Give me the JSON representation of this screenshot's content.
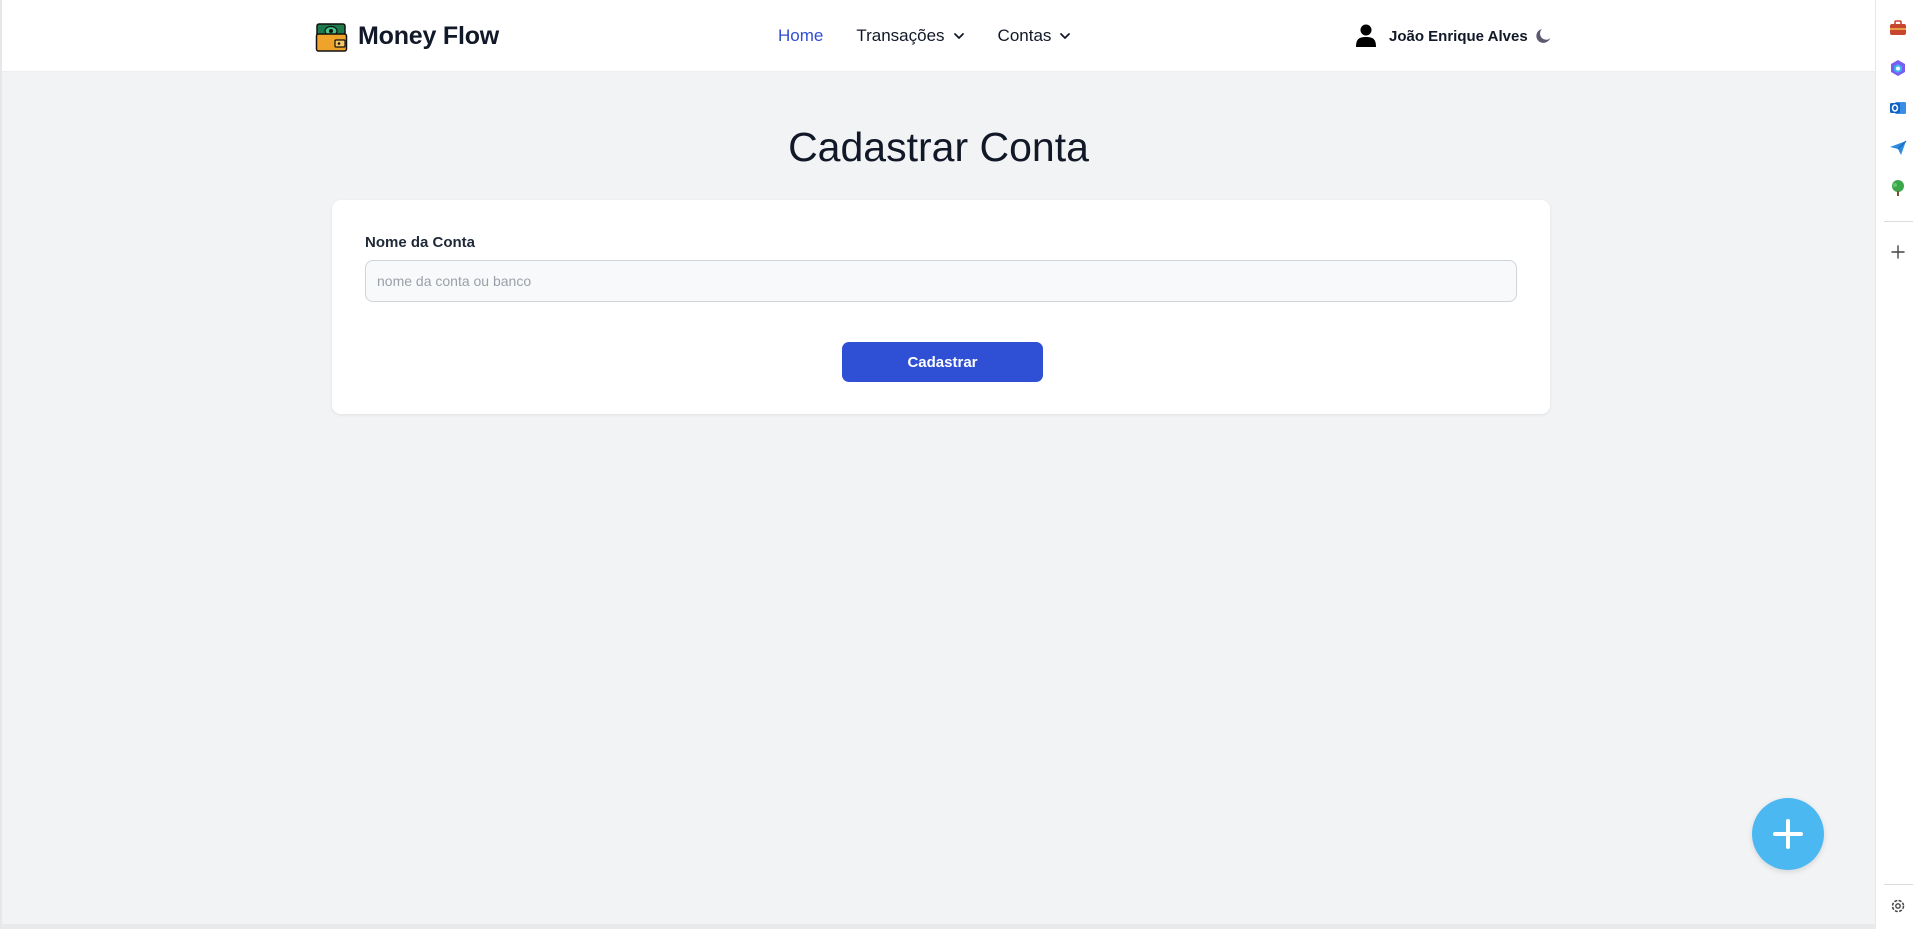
{
  "app": {
    "name": "Money Flow"
  },
  "nav": {
    "links": [
      {
        "label": "Home",
        "active": true
      },
      {
        "label": "Transações",
        "dropdown": true
      },
      {
        "label": "Contas",
        "dropdown": true
      }
    ]
  },
  "user": {
    "name": "João Enrique Alves",
    "theme_toggle_icon": "moon-icon"
  },
  "page": {
    "title": "Cadastrar Conta"
  },
  "form": {
    "account_name_label": "Nome da Conta",
    "account_name_placeholder": "nome da conta ou banco",
    "account_name_value": "",
    "submit_label": "Cadastrar"
  },
  "fab": {
    "icon": "plus-icon"
  },
  "browser_sidebar": {
    "icons": [
      "briefcase-icon",
      "copilot-icon",
      "outlook-icon",
      "send-icon",
      "tree-icon",
      "add-icon",
      "settings-icon"
    ]
  },
  "colors": {
    "accent": "#2f4fd4",
    "fab": "#4cb8f2",
    "background": "#f2f3f5"
  }
}
